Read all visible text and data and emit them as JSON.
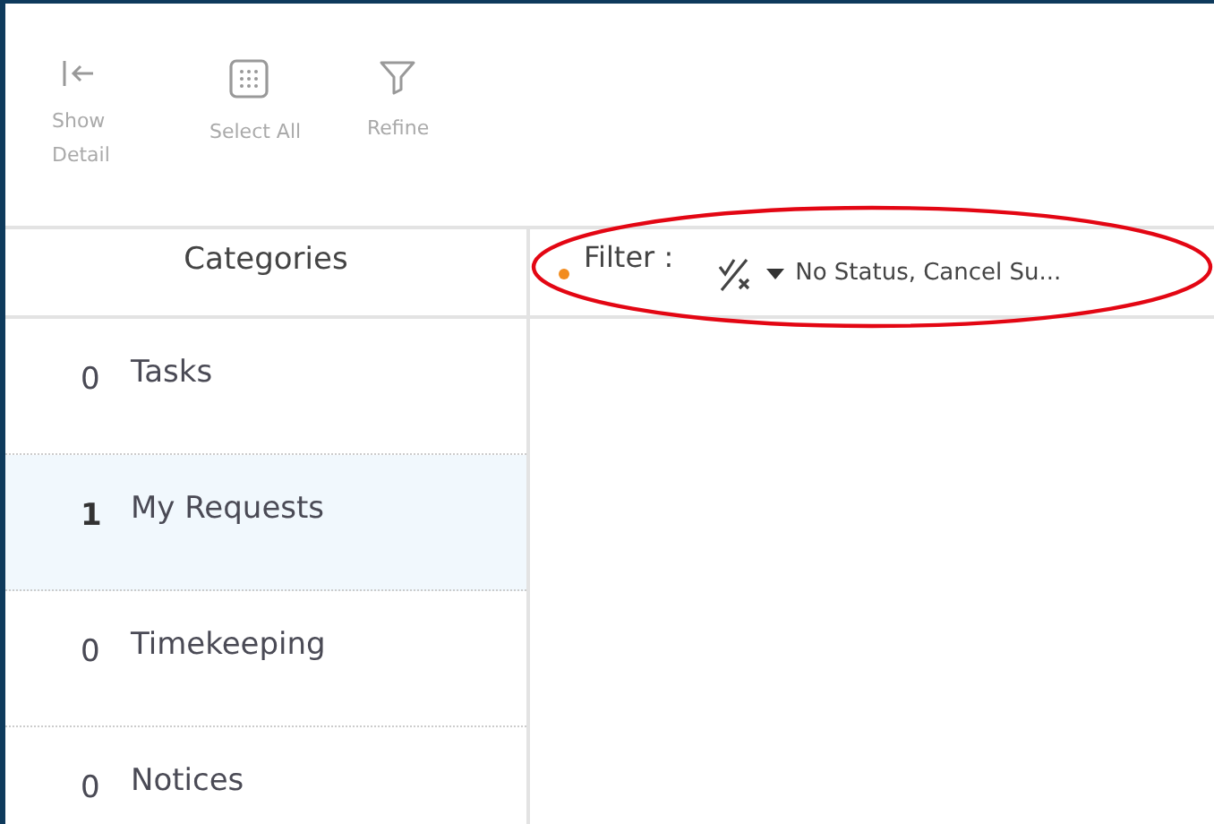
{
  "toolbar": [
    {
      "kind": "show-detail",
      "label": "Show\nDetail"
    },
    {
      "kind": "select-all",
      "label": "Select All"
    },
    {
      "kind": "refine",
      "label": "Refine"
    }
  ],
  "categories": {
    "title": "Categories",
    "items": [
      {
        "count": "0",
        "label": "Tasks",
        "selected": false
      },
      {
        "count": "1",
        "label": "My Requests",
        "selected": true
      },
      {
        "count": "0",
        "label": "Timekeeping",
        "selected": false
      },
      {
        "count": "0",
        "label": "Notices",
        "selected": false
      }
    ]
  },
  "filter": {
    "label": "Filter :",
    "active": true,
    "value": "No Status, Cancel Su..."
  },
  "annotation": {
    "kind": "ellipse",
    "color": "#e30613"
  }
}
